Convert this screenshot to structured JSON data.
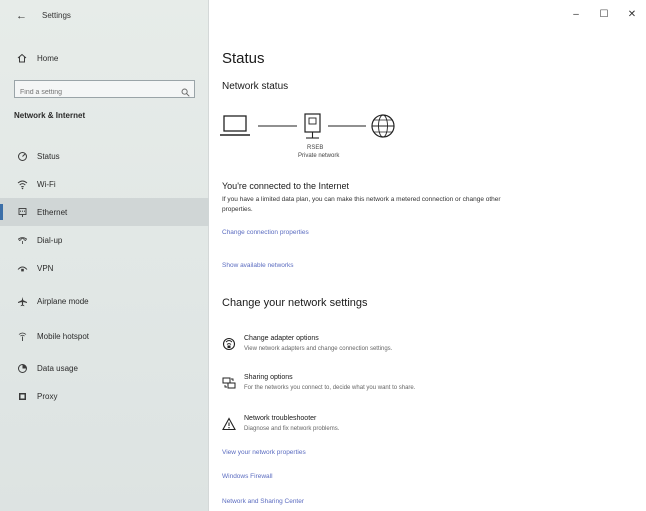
{
  "window": {
    "title": "Settings",
    "back_glyph": "←",
    "controls": {
      "minimize": "–",
      "maximize": "☐",
      "close": "✕"
    }
  },
  "sidebar": {
    "home_label": "Home",
    "search_placeholder": "Find a setting",
    "section_heading": "Network & Internet",
    "items": [
      {
        "label": "Status",
        "icon": "status-icon"
      },
      {
        "label": "Wi-Fi",
        "icon": "wifi-icon"
      },
      {
        "label": "Ethernet",
        "icon": "ethernet-icon",
        "selected": true
      },
      {
        "label": "Dial-up",
        "icon": "dialup-icon"
      },
      {
        "label": "VPN",
        "icon": "vpn-icon"
      },
      {
        "label": "Airplane mode",
        "icon": "airplane-icon"
      },
      {
        "label": "Mobile hotspot",
        "icon": "hotspot-icon"
      },
      {
        "label": "Data usage",
        "icon": "data-usage-icon"
      },
      {
        "label": "Proxy",
        "icon": "proxy-icon"
      }
    ]
  },
  "main": {
    "title": "Status",
    "network_status_heading": "Network status",
    "diagram": {
      "network_name": "RSEB",
      "network_type": "Private network"
    },
    "connected_title": "You're connected to the Internet",
    "connected_desc": "If you have a limited data plan, you can make this network a metered connection or change other properties.",
    "link_change_props": "Change connection properties",
    "link_show_networks": "Show available networks",
    "change_settings_heading": "Change your network settings",
    "options": [
      {
        "title": "Change adapter options",
        "desc": "View network adapters and change connection settings.",
        "icon": "adapter-icon"
      },
      {
        "title": "Sharing options",
        "desc": "For the networks you connect to, decide what you want to share.",
        "icon": "sharing-icon"
      },
      {
        "title": "Network troubleshooter",
        "desc": "Diagnose and fix network problems.",
        "icon": "warning-icon"
      }
    ],
    "link_view_properties": "View your network properties",
    "link_firewall": "Windows Firewall",
    "link_sharing_center": "Network and Sharing Center"
  },
  "colors": {
    "accent": "#3c6fa8",
    "link": "#5b6cc0",
    "sidebar_bg": "#e2e8e6"
  }
}
